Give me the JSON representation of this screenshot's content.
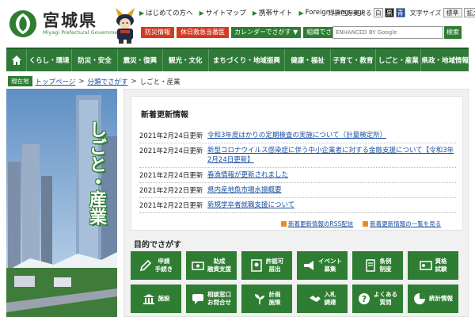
{
  "header": {
    "site_title": "宮城県",
    "site_subtitle": "Miyagi Prefectural Government",
    "top_links": [
      "はじめての方へ",
      "サイトマップ",
      "携帯サイト",
      "Foreign Language"
    ],
    "color_label": "背景色を変える",
    "color_options": [
      "白",
      "黒",
      "青"
    ],
    "font_label": "文字サイズ",
    "font_options": [
      "標準",
      "拡大"
    ],
    "red_buttons": [
      "防災情報",
      "休日救急当番医"
    ],
    "green_buttons": [
      "カレンダーでさがす",
      "組織でさがす"
    ],
    "search_placeholder": "ENHANCED BY Google",
    "search_button": "検索"
  },
  "nav": {
    "items": [
      "くらし・環境",
      "防災・安全",
      "震災・復興",
      "観光・文化",
      "まちづくり・地域振興",
      "健康・福祉",
      "子育て・教育",
      "しごと・産業",
      "県政・地域情報"
    ]
  },
  "breadcrumb": {
    "tag": "現在地",
    "items": [
      "トップページ",
      "分類でさがす",
      "しごと・産業"
    ]
  },
  "side": {
    "title": "しごと・産業"
  },
  "news": {
    "title": "新着更新情報",
    "items": [
      {
        "date": "2021年2月24日更新",
        "text": "令和3年度はかりの定期検査の実施について（計量検定所）"
      },
      {
        "date": "2021年2月24日更新",
        "text": "新型コロナウイルス感染症に伴う中小企業者に対する金融支援について【令和3年2月24日更新】"
      },
      {
        "date": "2021年2月24日更新",
        "text": "春漁情報が更新されました"
      },
      {
        "date": "2021年2月22日更新",
        "text": "県内産地魚市場水揚概要"
      },
      {
        "date": "2021年2月22日更新",
        "text": "新規学卒者就職支援について"
      }
    ],
    "rss_label": "新着更新情報のRSS配信",
    "list_label": "新着更新情報の一覧を見る"
  },
  "purpose": {
    "title": "目的でさがす",
    "tiles": [
      {
        "label": "申請\n手続き",
        "icon": "pen-icon"
      },
      {
        "label": "助成\n融資支援",
        "icon": "money-icon"
      },
      {
        "label": "許認可\n届出",
        "icon": "certificate-icon"
      },
      {
        "label": "イベント\n募集",
        "icon": "megaphone-icon"
      },
      {
        "label": "条例\n制度",
        "icon": "book-icon"
      },
      {
        "label": "資格\n試験",
        "icon": "id-card-icon"
      },
      {
        "label": "施設",
        "icon": "building-icon"
      },
      {
        "label": "相談窓口\nお問合せ",
        "icon": "chat-icon"
      },
      {
        "label": "計画\n施策",
        "icon": "plant-icon"
      },
      {
        "label": "入札\n調達",
        "icon": "handshake-icon"
      },
      {
        "label": "よくある\n質問",
        "icon": "question-icon"
      },
      {
        "label": "統計情報",
        "icon": "pie-chart-icon"
      }
    ]
  },
  "colors": {
    "brand_green": "#2e7d32",
    "alert_red": "#d23b22",
    "link_blue": "#1a4fa0"
  }
}
